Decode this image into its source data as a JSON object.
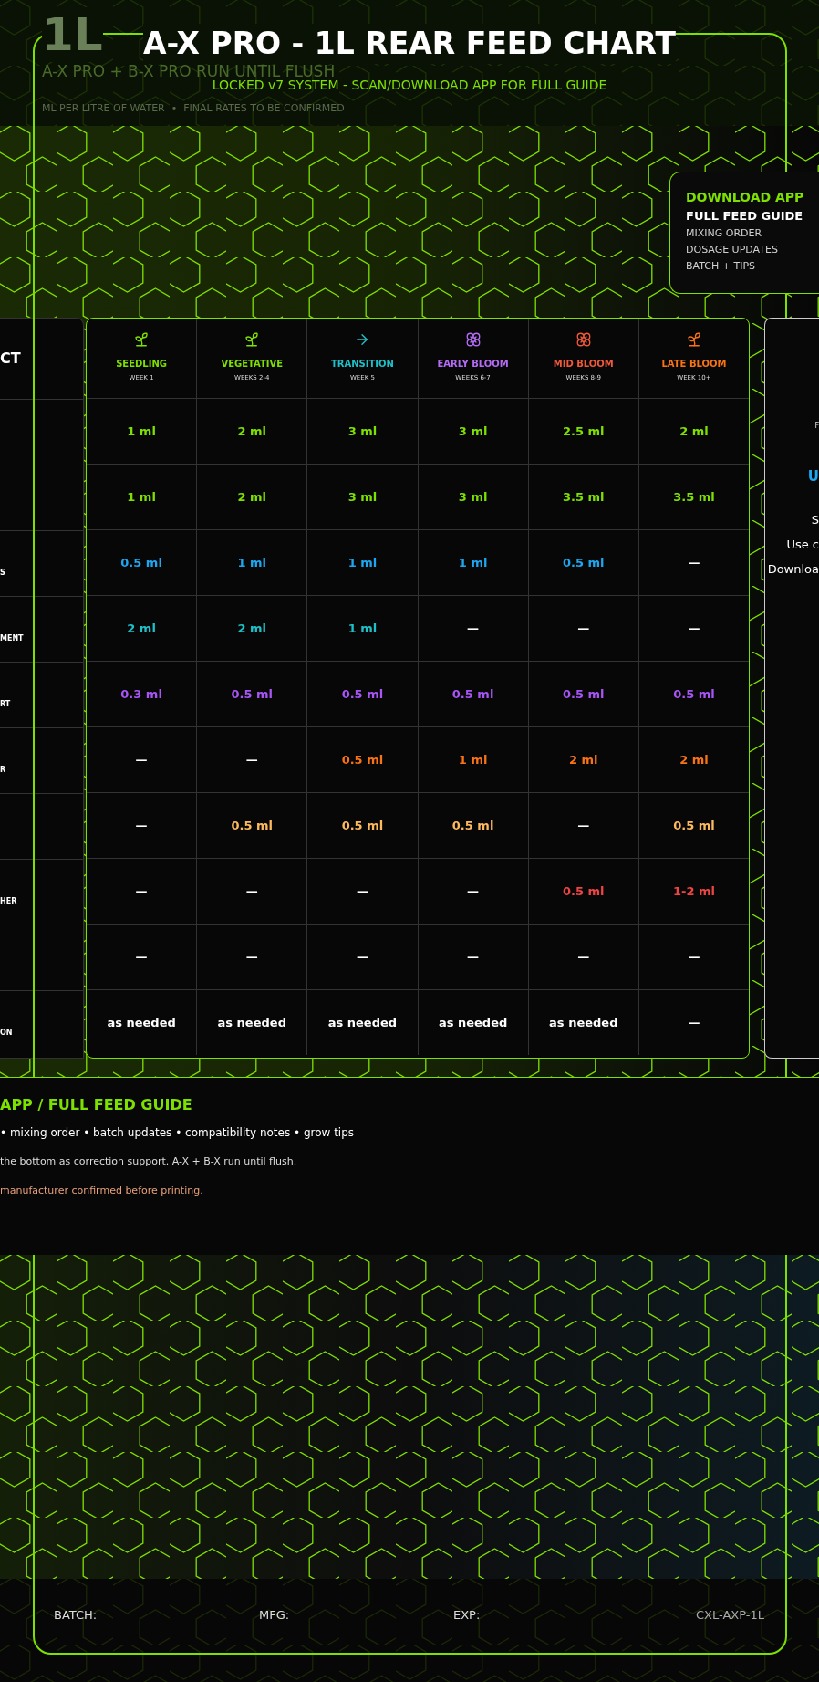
{
  "header": {
    "background_title": "1L",
    "background_subtitle": "A-X PRO + B-X PRO RUN UNTIL FLUSH",
    "background_note": "ML PER LITRE OF WATER  •  FINAL RATES TO BE CONFIRMED",
    "title": "A-X PRO - 1L REAR FEED CHART",
    "subtitle": "LOCKED v7 SYSTEM - SCAN/DOWNLOAD APP FOR FULL GUIDE"
  },
  "app_box": {
    "title": "DOWNLOAD APP",
    "heading": "FULL FEED GUIDE",
    "lines": [
      "MIXING ORDER",
      "DOSAGE UPDATES",
      "BATCH + TIPS"
    ]
  },
  "product_column": {
    "heading": "CT"
  },
  "table": {
    "stages": [
      {
        "name": "SEEDLING",
        "week": "WEEK 1",
        "color": "#7ee000",
        "kind": "sprout"
      },
      {
        "name": "VEGETATIVE",
        "week": "WEEKS 2-4",
        "color": "#7ee000",
        "kind": "sprout"
      },
      {
        "name": "TRANSITION",
        "week": "WEEK 5",
        "color": "#1fc0c8",
        "kind": "arrow"
      },
      {
        "name": "EARLY BLOOM",
        "week": "WEEKS 6-7",
        "color": "#b46cf5",
        "kind": "flower"
      },
      {
        "name": "MID BLOOM",
        "week": "WEEKS 8-9",
        "color": "#f0583a",
        "kind": "flower"
      },
      {
        "name": "LATE BLOOM",
        "week": "WEEK 10+",
        "color": "#f97316",
        "kind": "sprout"
      }
    ],
    "rows": [
      {
        "color": "#7ee000",
        "cells": [
          {
            "text": "1 ml",
            "kind": "dose"
          },
          {
            "text": "2 ml",
            "kind": "dose"
          },
          {
            "text": "3 ml",
            "kind": "dose"
          },
          {
            "text": "3 ml",
            "kind": "dose"
          },
          {
            "text": "2.5 ml",
            "kind": "dose"
          },
          {
            "text": "2 ml",
            "kind": "dose"
          }
        ]
      },
      {
        "color": "#7ee000",
        "cells": [
          {
            "text": "1 ml",
            "kind": "dose"
          },
          {
            "text": "2 ml",
            "kind": "dose"
          },
          {
            "text": "3 ml",
            "kind": "dose"
          },
          {
            "text": "3 ml",
            "kind": "dose"
          },
          {
            "text": "3.5 ml",
            "kind": "dose"
          },
          {
            "text": "3.5 ml",
            "kind": "dose"
          }
        ]
      },
      {
        "label": "S",
        "color": "#1ea7f0",
        "cells": [
          {
            "text": "0.5 ml",
            "kind": "dose"
          },
          {
            "text": "1 ml",
            "kind": "dose"
          },
          {
            "text": "1 ml",
            "kind": "dose"
          },
          {
            "text": "1 ml",
            "kind": "dose"
          },
          {
            "text": "0.5 ml",
            "kind": "dose"
          },
          {
            "text": "—",
            "kind": "none"
          }
        ]
      },
      {
        "label": "MENT",
        "color": "#1fc0c8",
        "cells": [
          {
            "text": "2 ml",
            "kind": "dose"
          },
          {
            "text": "2 ml",
            "kind": "dose"
          },
          {
            "text": "1 ml",
            "kind": "dose"
          },
          {
            "text": "—",
            "kind": "none"
          },
          {
            "text": "—",
            "kind": "none"
          },
          {
            "text": "—",
            "kind": "none"
          }
        ]
      },
      {
        "label": "RT",
        "color": "#a855f7",
        "cells": [
          {
            "text": "0.3 ml",
            "kind": "dose"
          },
          {
            "text": "0.5 ml",
            "kind": "dose"
          },
          {
            "text": "0.5 ml",
            "kind": "dose"
          },
          {
            "text": "0.5 ml",
            "kind": "dose"
          },
          {
            "text": "0.5 ml",
            "kind": "dose"
          },
          {
            "text": "0.5 ml",
            "kind": "dose"
          }
        ]
      },
      {
        "label": "R",
        "color": "#f97316",
        "cells": [
          {
            "text": "—",
            "kind": "none"
          },
          {
            "text": "—",
            "kind": "none"
          },
          {
            "text": "0.5 ml",
            "kind": "dose"
          },
          {
            "text": "1 ml",
            "kind": "dose"
          },
          {
            "text": "2 ml",
            "kind": "dose"
          },
          {
            "text": "2 ml",
            "kind": "dose"
          }
        ]
      },
      {
        "color": "#fdba5c",
        "cells": [
          {
            "text": "—",
            "kind": "none"
          },
          {
            "text": "0.5 ml",
            "kind": "dose"
          },
          {
            "text": "0.5 ml",
            "kind": "dose"
          },
          {
            "text": "0.5 ml",
            "kind": "dose"
          },
          {
            "text": "—",
            "kind": "none"
          },
          {
            "text": "0.5 ml",
            "kind": "dose"
          }
        ]
      },
      {
        "label": "HER",
        "color": "#ef4444",
        "cells": [
          {
            "text": "—",
            "kind": "none"
          },
          {
            "text": "—",
            "kind": "none"
          },
          {
            "text": "—",
            "kind": "none"
          },
          {
            "text": "—",
            "kind": "none"
          },
          {
            "text": "0.5 ml",
            "kind": "dose"
          },
          {
            "text": "1-2 ml",
            "kind": "dose"
          }
        ]
      },
      {
        "cells": [
          {
            "text": "—",
            "kind": "none"
          },
          {
            "text": "—",
            "kind": "none"
          },
          {
            "text": "—",
            "kind": "none"
          },
          {
            "text": "—",
            "kind": "none"
          },
          {
            "text": "—",
            "kind": "none"
          },
          {
            "text": "—",
            "kind": "none"
          }
        ]
      },
      {
        "label": "ON",
        "color": "#ffffff",
        "cells": [
          {
            "text": "as needed",
            "kind": "dose"
          },
          {
            "text": "as needed",
            "kind": "dose"
          },
          {
            "text": "as needed",
            "kind": "dose"
          },
          {
            "text": "as needed",
            "kind": "dose"
          },
          {
            "text": "as needed",
            "kind": "dose"
          },
          {
            "text": "—",
            "kind": "none"
          }
        ]
      }
    ]
  },
  "right_panel": [
    {
      "text": "F",
      "kind": "tiny"
    },
    {
      "text": "U",
      "kind": "accent"
    },
    {
      "text": "S",
      "kind": "body"
    },
    {
      "text": "Use c",
      "kind": "body"
    },
    {
      "text": "Downloa",
      "kind": "body"
    }
  ],
  "bottom": {
    "heading": "APP / FULL FEED GUIDE",
    "features": "• mixing order • batch updates • compatibility notes • grow tips",
    "notes": "the bottom as correction support. A-X + B-X run until flush.",
    "warning": "manufacturer confirmed before printing."
  },
  "footer": {
    "batch": "BATCH:",
    "mfg": "MFG:",
    "exp": "EXP:",
    "code": "CXL-AXP-1L"
  }
}
